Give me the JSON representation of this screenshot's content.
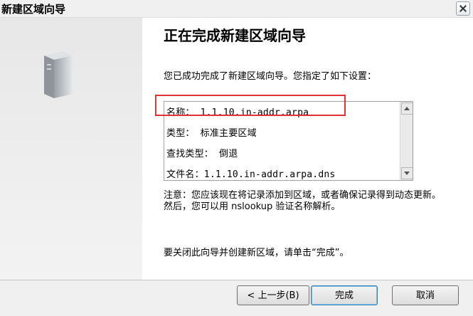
{
  "window": {
    "title": "新建区域向导"
  },
  "heading": "正在完成新建区域向导",
  "intro": "您已成功完成了新建区域向导。您指定了如下设置：",
  "summary": {
    "rows": [
      "名称：  1.1.10.in-addr.arpa",
      "类型：  标准主要区域",
      "查找类型：      倒退",
      "文件名：1.1.10.in-addr.arpa.dns"
    ]
  },
  "note": "注意：您应该现在将记录添加到区域，或者确保记录得到动态更新。然后，您可以用 nslookup 验证名称解析。",
  "closing": "要关闭此向导并创建新区域，请单击“完成”。",
  "buttons": {
    "back": "< 上一步(B)",
    "finish": "完成",
    "cancel": "取消"
  },
  "icons": {
    "server": "server-icon",
    "close": "close-icon"
  },
  "colors": {
    "highlight": "#e03434"
  }
}
